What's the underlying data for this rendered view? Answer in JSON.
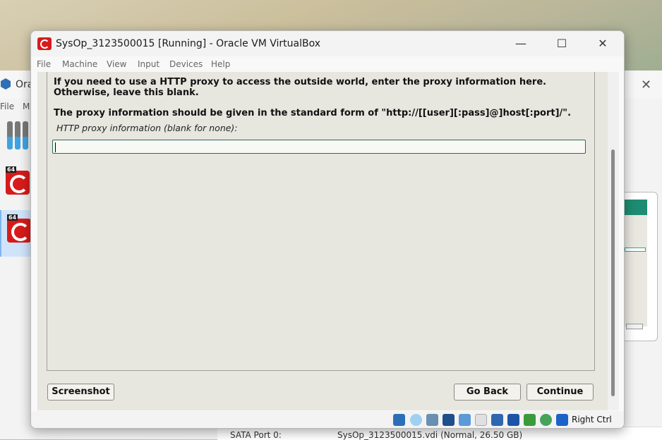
{
  "background": {
    "manager_title": "Ora",
    "manager_menu": [
      "File",
      "M"
    ],
    "vm_badge": "64",
    "storage_key": "SATA Port 0:",
    "storage_value": "SysOp_3123500015.vdi (Normal, 26.50 GB)"
  },
  "window": {
    "title": "SysOp_3123500015 [Running] - Oracle VM VirtualBox",
    "controls": {
      "minimize": "—",
      "maximize": "☐",
      "close": "✕"
    },
    "menu": [
      "File",
      "Machine",
      "View",
      "Input",
      "Devices",
      "Help"
    ]
  },
  "installer": {
    "paragraph1": "If you need to use a HTTP proxy to access the outside world, enter the proxy information here. Otherwise, leave this blank.",
    "paragraph2": "The proxy information should be given in the standard form of \"http://[[user][:pass]@]host[:port]/\".",
    "field_label": "HTTP proxy information (blank for none):",
    "field_value": "",
    "buttons": {
      "screenshot": "Screenshot",
      "go_back": "Go Back",
      "continue": "Continue"
    }
  },
  "statusbar": {
    "icons": [
      "hard-disk-icon",
      "optical-drive-icon",
      "audio-icon",
      "network-icon",
      "usb-icon",
      "shared-folder-icon",
      "display-icon",
      "recording-icon",
      "cpu-icon",
      "mouse-integration-icon",
      "keyboard-icon"
    ],
    "host_key": "Right Ctrl"
  },
  "colors": {
    "installer_bg": "#e7e6df",
    "input_border": "#2a6b58",
    "accent_red": "#d71b1b"
  }
}
